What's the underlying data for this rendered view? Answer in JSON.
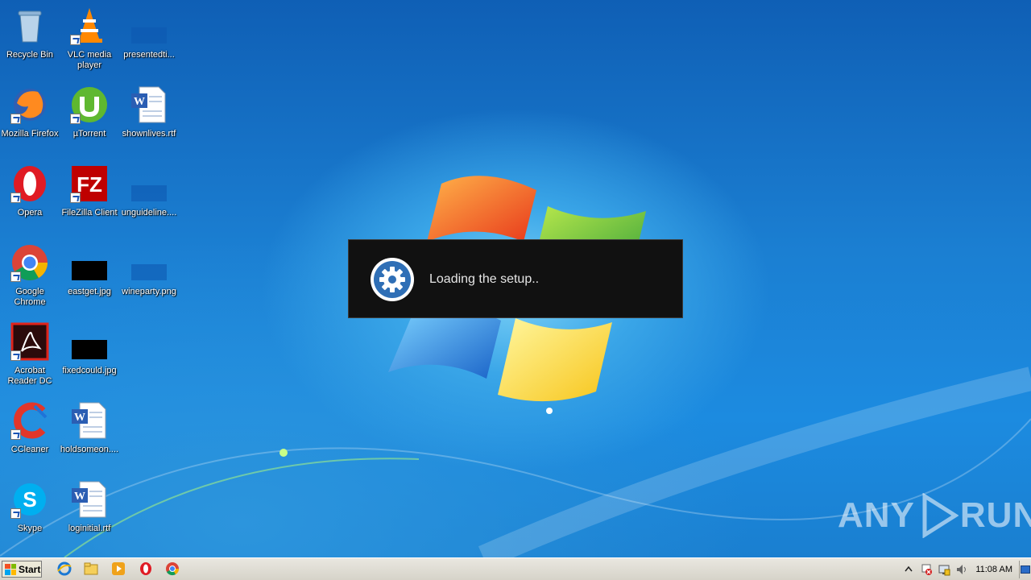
{
  "desktop": {
    "icons": [
      {
        "label": "Recycle Bin",
        "icon": "recycle-bin-icon"
      },
      {
        "label": "VLC media player",
        "icon": "vlc-icon"
      },
      {
        "label": "presentedti...",
        "icon": "blank-file-icon"
      },
      {
        "label": "Mozilla Firefox",
        "icon": "firefox-icon"
      },
      {
        "label": "µTorrent",
        "icon": "utorrent-icon"
      },
      {
        "label": "shownlives.rtf",
        "icon": "word-document-icon"
      },
      {
        "label": "Opera",
        "icon": "opera-icon"
      },
      {
        "label": "FileZilla Client",
        "icon": "filezilla-icon"
      },
      {
        "label": "unguideline....",
        "icon": "blank-file-icon"
      },
      {
        "label": "Google Chrome",
        "icon": "chrome-icon"
      },
      {
        "label": "eastget.jpg",
        "icon": "image-file-icon"
      },
      {
        "label": "wineparty.png",
        "icon": "blank-file-icon"
      },
      {
        "label": "Acrobat Reader DC",
        "icon": "acrobat-icon"
      },
      {
        "label": "fixedcould.jpg",
        "icon": "image-file-icon"
      },
      {
        "label": "CCleaner",
        "icon": "ccleaner-icon"
      },
      {
        "label": "holdsomeon....",
        "icon": "word-document-icon"
      },
      {
        "label": "Skype",
        "icon": "skype-icon"
      },
      {
        "label": "loginitial.rtf",
        "icon": "word-document-icon"
      }
    ]
  },
  "dialog": {
    "message": "Loading the setup..",
    "icon": "gear-icon"
  },
  "taskbar": {
    "start_label": "Start",
    "quick_launch": [
      "internet-explorer-icon",
      "explorer-folder-icon",
      "media-player-icon",
      "opera-icon",
      "chrome-icon"
    ],
    "tray_icons": [
      "show-hidden-icons-arrow",
      "action-center-flag-icon",
      "network-icon",
      "volume-icon"
    ],
    "clock": "11:08 AM"
  },
  "watermark": {
    "left": "ANY",
    "right": "RUN"
  }
}
